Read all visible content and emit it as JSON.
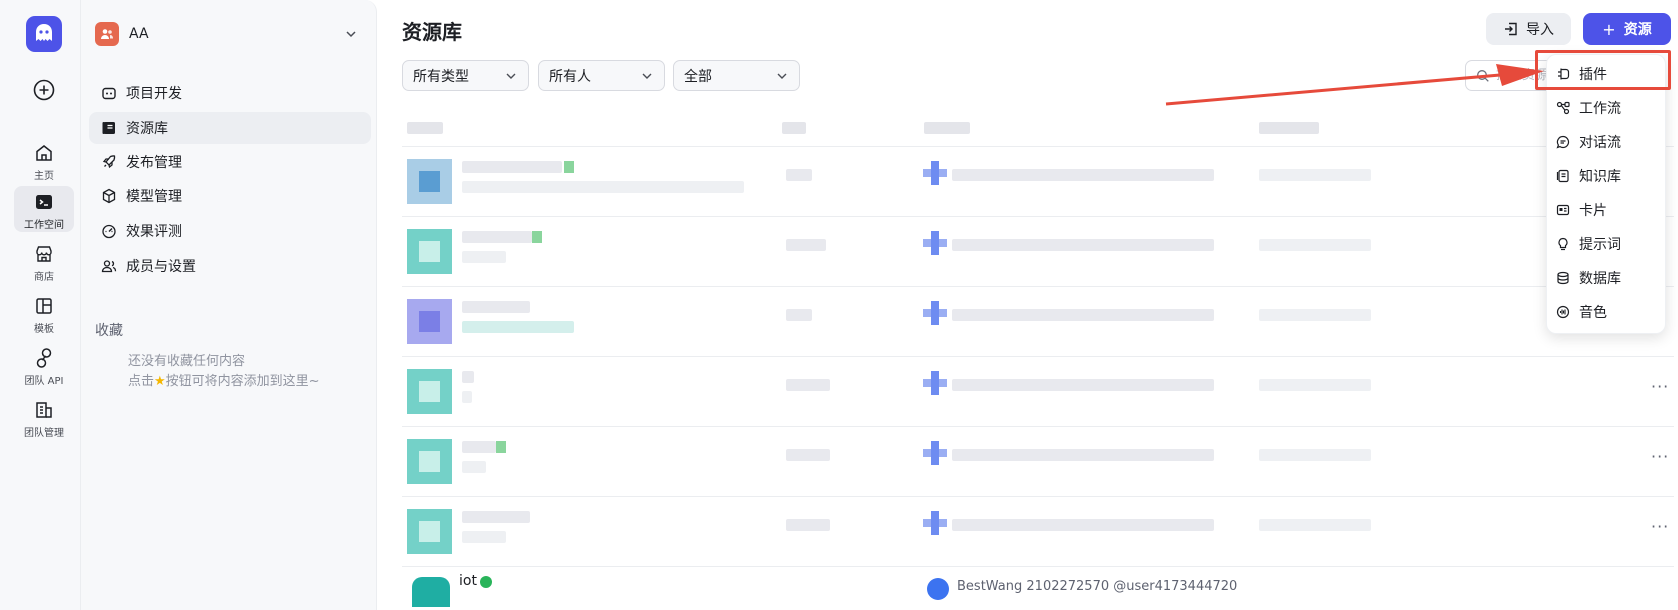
{
  "sidebar_rail": {
    "items": [
      {
        "label": "主页",
        "icon": "home-icon"
      },
      {
        "label": "工作空间",
        "icon": "terminal-icon",
        "active": true
      },
      {
        "label": "商店",
        "icon": "store-icon"
      },
      {
        "label": "模板",
        "icon": "template-icon"
      },
      {
        "label": "团队 API",
        "icon": "link-icon"
      },
      {
        "label": "团队管理",
        "icon": "building-icon"
      }
    ]
  },
  "workspace": {
    "name": "AA",
    "nav": [
      {
        "label": "项目开发",
        "icon": "robot-icon"
      },
      {
        "label": "资源库",
        "icon": "library-icon",
        "active": true
      },
      {
        "label": "发布管理",
        "icon": "rocket-icon"
      },
      {
        "label": "模型管理",
        "icon": "cube-icon"
      },
      {
        "label": "效果评测",
        "icon": "gauge-icon"
      },
      {
        "label": "成员与设置",
        "icon": "users-icon"
      }
    ],
    "favorites": {
      "title": "收藏",
      "empty_line1": "还没有收藏任何内容",
      "empty_line2_prefix": "点击",
      "empty_line2_suffix": "按钮可将内容添加到这里~"
    }
  },
  "main": {
    "title": "资源库",
    "import_label": "导入",
    "new_label": "资源",
    "filters": {
      "type": "所有类型",
      "owner": "所有人",
      "status": "全部"
    },
    "search_placeholder": "搜索资源",
    "last_row": {
      "name": "iot",
      "owner": "BestWang 2102272570 @user4173444720"
    }
  },
  "create_menu": {
    "items": [
      {
        "label": "插件",
        "icon": "plugin-icon"
      },
      {
        "label": "工作流",
        "icon": "workflow-icon"
      },
      {
        "label": "对话流",
        "icon": "chatflow-icon"
      },
      {
        "label": "知识库",
        "icon": "knowledge-icon"
      },
      {
        "label": "卡片",
        "icon": "card-icon"
      },
      {
        "label": "提示词",
        "icon": "bulb-icon"
      },
      {
        "label": "数据库",
        "icon": "database-icon"
      },
      {
        "label": "音色",
        "icon": "voice-icon"
      }
    ]
  },
  "colors": {
    "accent": "#4d53e8",
    "annotation": "#e64a3b"
  }
}
